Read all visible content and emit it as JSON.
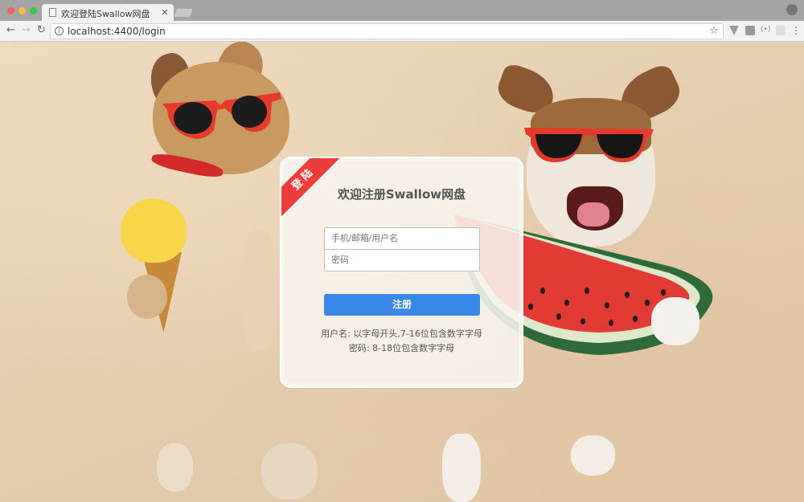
{
  "browser": {
    "tab_title": "欢迎登陆Swallow网盘",
    "tab_close": "×",
    "url": "localhost:4400/login",
    "nav_back": "←",
    "nav_forward": "→",
    "nav_reload": "↻",
    "star": "☆",
    "menu": "⋮",
    "ext_label": "(•)"
  },
  "login": {
    "ribbon": "登陆",
    "title": "欢迎注册Swallow网盘",
    "username_placeholder": "手机/邮箱/用户名",
    "password_placeholder": "密码",
    "submit_label": "注册",
    "hint_username": "用户名: 以字母开头,7-16位包含数字字母",
    "hint_password": "密码: 8-18位包含数字字母"
  },
  "colors": {
    "accent": "#3a87ea",
    "ribbon": "#ec3c3c"
  },
  "icons": [
    "page-icon",
    "info-icon",
    "star-icon",
    "back-icon",
    "forward-icon",
    "reload-icon",
    "menu-icon"
  ]
}
